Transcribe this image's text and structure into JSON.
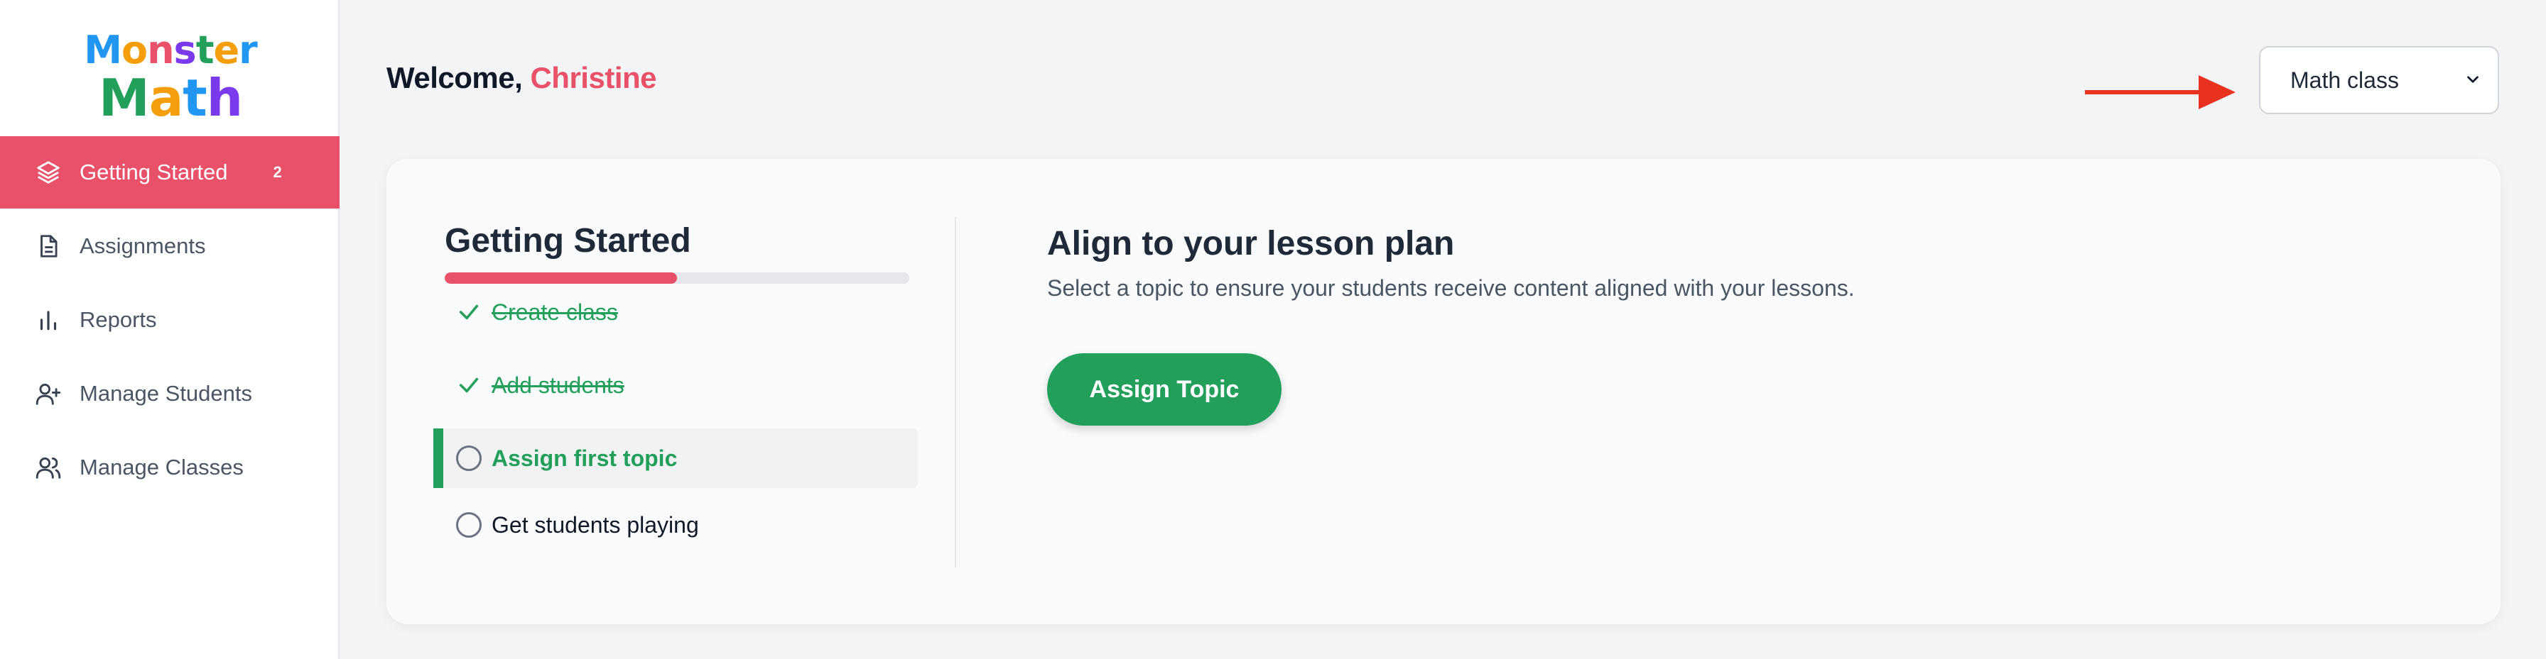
{
  "logo": {
    "line1": [
      "M",
      "o",
      "n",
      "s",
      "t",
      "e",
      "r"
    ],
    "line1_colors": [
      "#2196f3",
      "#f59e0b",
      "#e9516a",
      "#7c3aed",
      "#22a05b",
      "#f59e0b",
      "#2196f3"
    ],
    "line2": [
      "M",
      "a",
      "t",
      "h"
    ],
    "line2_colors": [
      "#22a05b",
      "#f59e0b",
      "#2196f3",
      "#7c3aed"
    ]
  },
  "sidebar": {
    "items": [
      {
        "label": "Getting Started",
        "icon": "layers-icon",
        "badge": "2",
        "active": true
      },
      {
        "label": "Assignments",
        "icon": "document-icon"
      },
      {
        "label": "Reports",
        "icon": "bar-chart-icon"
      },
      {
        "label": "Manage Students",
        "icon": "user-plus-icon"
      },
      {
        "label": "Manage Classes",
        "icon": "users-icon"
      }
    ]
  },
  "header": {
    "welcome_prefix": "Welcome,",
    "user_name": "Christine",
    "class_select_value": "Math class"
  },
  "getting_started": {
    "title": "Getting Started",
    "progress_fraction": 0.5,
    "tasks": [
      {
        "label": "Create class",
        "status": "done"
      },
      {
        "label": "Add students",
        "status": "done"
      },
      {
        "label": "Assign first topic",
        "status": "current"
      },
      {
        "label": "Get students playing",
        "status": "pending"
      }
    ]
  },
  "step_panel": {
    "title": "Align to your lesson plan",
    "subtitle": "Select a topic to ensure your students receive content aligned with your lessons.",
    "button_label": "Assign Topic"
  },
  "colors": {
    "accent": "#e9516a",
    "success": "#22a05b",
    "annotation_arrow": "#e8321f"
  }
}
